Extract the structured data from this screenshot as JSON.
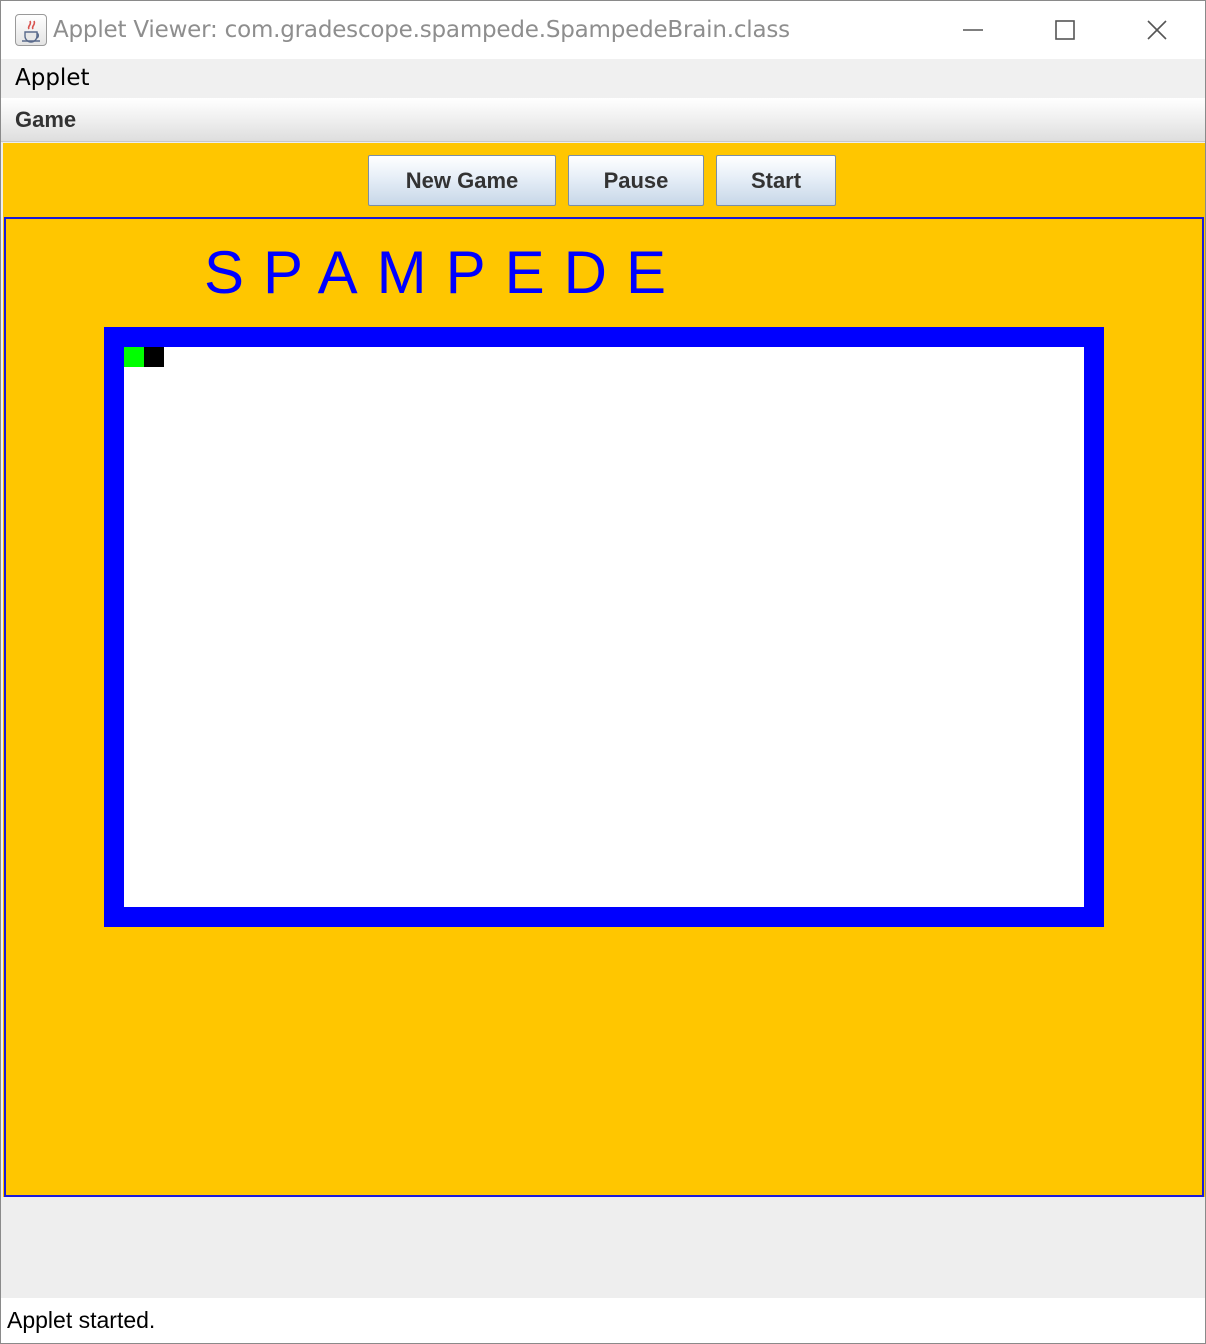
{
  "window": {
    "title": "Applet Viewer: com.gradescope.spampede.SpampedeBrain.class",
    "icon": "java-cup-icon"
  },
  "menubar": {
    "applet_menu": "Applet",
    "game_menu": "Game"
  },
  "toolbar": {
    "new_game_label": "New Game",
    "pause_label": "Pause",
    "start_label": "Start"
  },
  "game": {
    "title": "SPAMPEDE",
    "snake": {
      "head_color": "#00ff00",
      "body_color": "#000000"
    },
    "background_color": "#ffc600",
    "border_color": "#0000ff"
  },
  "status": {
    "text": "Applet started."
  }
}
